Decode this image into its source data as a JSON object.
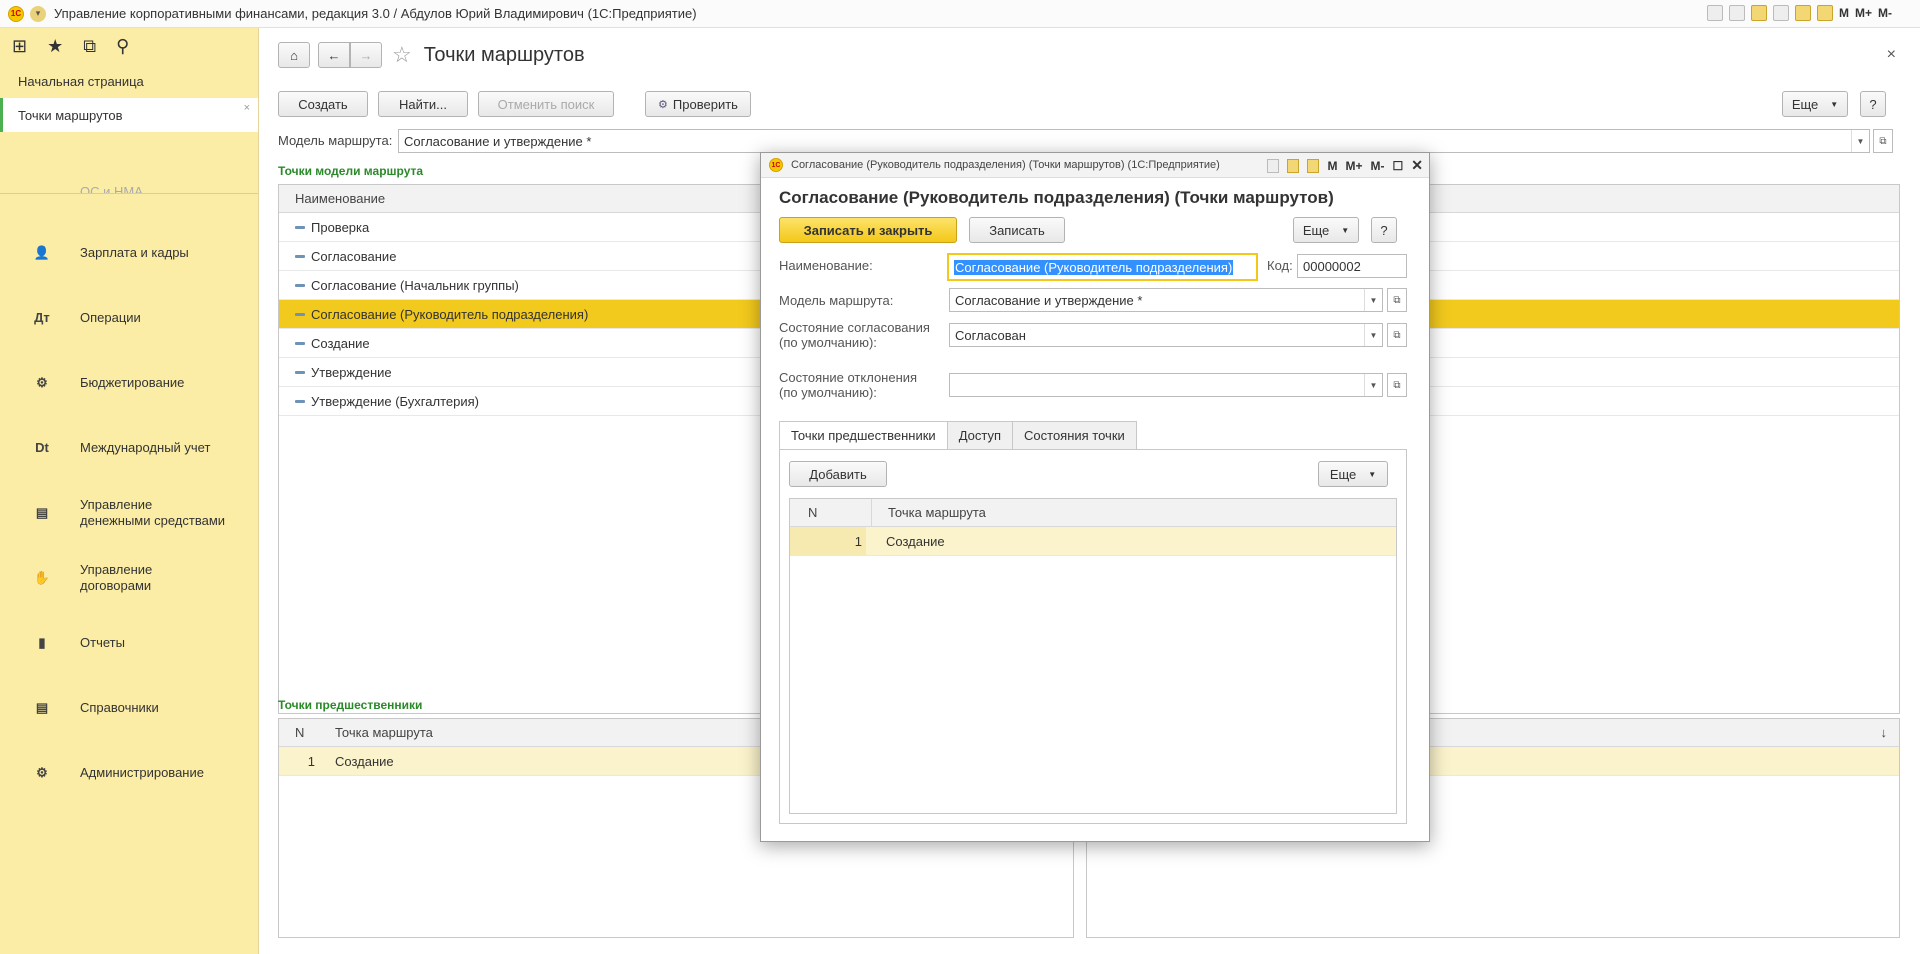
{
  "window": {
    "title": "Управление корпоративными финансами, редакция 3.0 / Абдулов Юрий Владимирович (1С:Предприятие)",
    "logo_text": "1С",
    "m_labels": [
      "M",
      "M+",
      "M-"
    ]
  },
  "sidebar": {
    "toolbar_icons": [
      "apps-grid-icon",
      "star-icon",
      "history-icon",
      "search-icon"
    ],
    "open_items": [
      {
        "label": "Начальная страница"
      },
      {
        "label": "Точки маршрутов",
        "close": "×"
      }
    ],
    "cut_item": "ОС и НМА",
    "sections": [
      {
        "label": "Зарплата и кадры",
        "icon": "person-icon",
        "glyph": "👤"
      },
      {
        "label": "Операции",
        "icon": "dt-kt-icon",
        "glyph": "Дт"
      },
      {
        "label": "Бюджетирование",
        "icon": "budget-icon",
        "glyph": "⚙"
      },
      {
        "label": "Международный учет",
        "icon": "dt-ct-icon",
        "glyph": "Dt"
      },
      {
        "label": "Управление\nденежными средствами",
        "icon": "money-icon",
        "glyph": "▤"
      },
      {
        "label": "Управление\nдоговорами",
        "icon": "handshake-icon",
        "glyph": "✋"
      },
      {
        "label": "Отчеты",
        "icon": "chart-icon",
        "glyph": "▮"
      },
      {
        "label": "Справочники",
        "icon": "book-icon",
        "glyph": "▤"
      },
      {
        "label": "Администрирование",
        "icon": "gear-icon",
        "glyph": "⚙"
      }
    ]
  },
  "main": {
    "page_title": "Точки маршрутов",
    "close": "×",
    "toolbar": {
      "create": "Создать",
      "find": "Найти...",
      "cancel_search": "Отменить поиск",
      "check": "Проверить",
      "more": "Еще",
      "help": "?"
    },
    "model_label": "Модель маршрута:",
    "model_value": "Согласование и утверждение *",
    "points_section": "Точки модели маршрута",
    "points_header": "Наименование",
    "points": [
      "Проверка",
      "Согласование",
      "Согласование (Начальник группы)",
      "Согласование (Руководитель подразделения)",
      "Создание",
      "Утверждение",
      "Утверждение (Бухгалтерия)"
    ],
    "selected_index": 3,
    "pred_section": "Точки предшественники",
    "pred_headers": {
      "n": "N",
      "point": "Точка маршрута"
    },
    "pred_rows": [
      {
        "n": "1",
        "point": "Создание"
      }
    ],
    "sort_icon": "↓"
  },
  "modal": {
    "titlebar": "Согласование (Руководитель подразделения) (Точки маршрутов) (1С:Предприятие)",
    "heading": "Согласование (Руководитель подразделения) (Точки маршрутов)",
    "save_close": "Записать и закрыть",
    "save": "Записать",
    "more": "Еще",
    "help": "?",
    "name_label": "Наименование:",
    "name_value": "Согласование (Руководитель подразделения)",
    "code_label": "Код:",
    "code_value": "00000002",
    "model_label": "Модель маршрута:",
    "model_value": "Согласование и утверждение *",
    "approval_state_label_1": "Состояние согласования",
    "approval_state_label_2": "(по умолчанию):",
    "approval_state_value": "Согласован",
    "reject_state_label_1": "Состояние отклонения",
    "reject_state_label_2": "(по умолчанию):",
    "reject_state_value": "",
    "tabs": [
      "Точки предшественники",
      "Доступ",
      "Состояния точки"
    ],
    "add": "Добавить",
    "table_headers": {
      "n": "N",
      "point": "Точка маршрута"
    },
    "rows": [
      {
        "n": "1",
        "point": "Создание"
      }
    ]
  },
  "colors": {
    "sidebar_bg": "#fbeda5",
    "selected_row": "#f2c91d",
    "section_title": "#2a8a2a",
    "primary_button": "#f3c818"
  }
}
